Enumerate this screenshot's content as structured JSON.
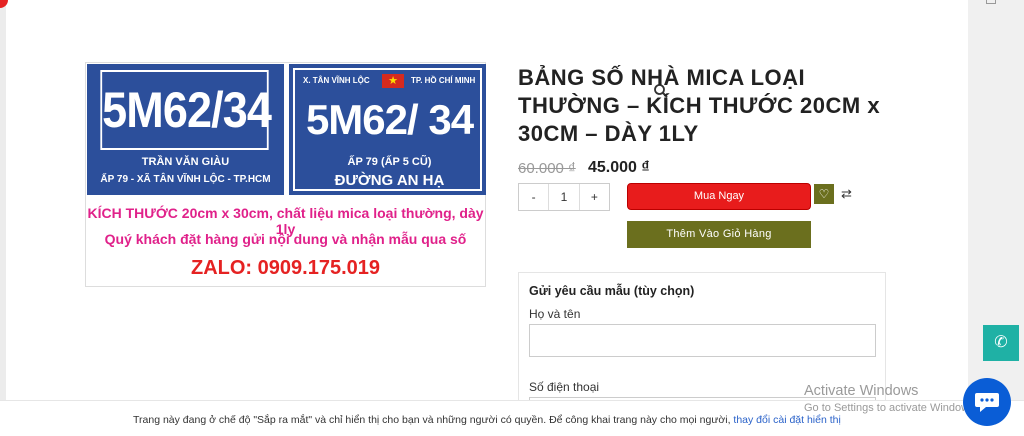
{
  "product_image": {
    "plate1": {
      "number": "5M62/34",
      "line1": "TRẦN VĂN GIÀU",
      "line2": "ẤP 79 - XÃ TÂN VĨNH LỘC - TP.HCM"
    },
    "plate2": {
      "top_left": "X. TÂN VĨNH LỘC",
      "top_right": "TP. HỒ CHÍ MINH",
      "number": "5M62/ 34",
      "middle": "ẤP 79 (ẤP 5 CŨ)",
      "bottom": "ĐƯỜNG AN HẠ"
    },
    "caption1": "KÍCH THƯỚC 20cm x 30cm, chất liệu mica loại thường, dày 1ly",
    "caption2": "Quý khách đặt hàng gửi nội dung và nhận mẫu qua số",
    "caption3": "ZALO: 0909.175.019",
    "zoom_icon": "search-icon"
  },
  "product": {
    "title": "BẢNG SỐ NHÀ MICA LOẠI THƯỜNG – KÍCH THƯỚC 20CM x 30CM – DÀY 1LY",
    "price_old": "60.000 ₫",
    "price_new": "45.000 ₫",
    "quantity": "1",
    "minus": "-",
    "plus": "+",
    "buy_now": "Mua Ngay",
    "add_to_cart": "Thêm Vào Giỏ Hàng"
  },
  "form": {
    "title": "Gửi yêu cầu mẫu (tùy chọn)",
    "name_label": "Họ và tên",
    "phone_label": "Số điện thoại"
  },
  "notice": {
    "text": "Trang này đang ở chế độ \"Sắp ra mắt\" và chỉ hiển thị cho bạn và những người có quyền. Để công khai trang này cho mọi người, ",
    "link": "thay đổi cài đặt hiển thị"
  },
  "watermark": {
    "line1": "Activate Windows",
    "line2": "Go to Settings to activate Windows."
  },
  "colors": {
    "buy_button": "#e81c1c",
    "cart_button": "#6b6f1e",
    "plate_blue": "#2c4f9b",
    "caption_pink": "#e0218a"
  }
}
